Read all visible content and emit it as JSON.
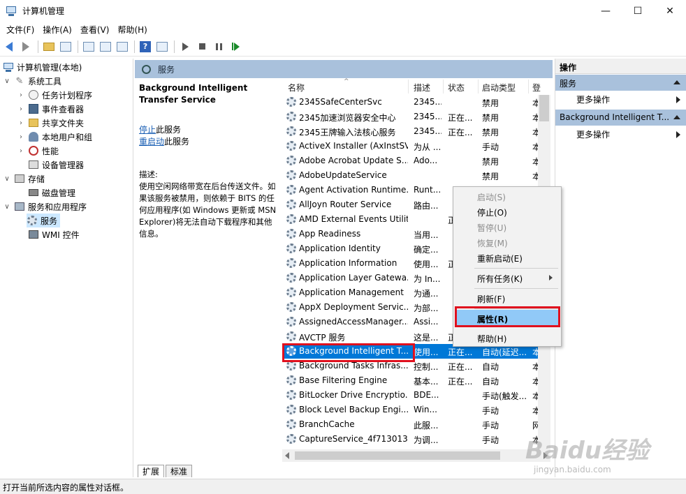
{
  "window": {
    "title": "计算机管理",
    "minimize": "—",
    "maximize": "☐",
    "close": "✕"
  },
  "menubar": [
    "文件(F)",
    "操作(A)",
    "查看(V)",
    "帮助(H)"
  ],
  "tree": [
    {
      "label": "计算机管理(本地)",
      "icon": "computer-icon",
      "twisty": ""
    },
    {
      "label": "系统工具",
      "icon": "tools-icon",
      "twisty": "∨"
    },
    {
      "label": "任务计划程序",
      "icon": "clock-icon",
      "twisty": "›"
    },
    {
      "label": "事件查看器",
      "icon": "event-viewer-icon",
      "twisty": "›"
    },
    {
      "label": "共享文件夹",
      "icon": "shared-folder-icon",
      "twisty": "›"
    },
    {
      "label": "本地用户和组",
      "icon": "users-icon",
      "twisty": "›"
    },
    {
      "label": "性能",
      "icon": "performance-icon",
      "twisty": "›"
    },
    {
      "label": "设备管理器",
      "icon": "device-manager-icon",
      "twisty": ""
    },
    {
      "label": "存储",
      "icon": "storage-icon",
      "twisty": "∨"
    },
    {
      "label": "磁盘管理",
      "icon": "disk-icon",
      "twisty": ""
    },
    {
      "label": "服务和应用程序",
      "icon": "services-apps-icon",
      "twisty": "∨"
    },
    {
      "label": "服务",
      "icon": "gear-icon",
      "twisty": ""
    },
    {
      "label": "WMI 控件",
      "icon": "wmi-icon",
      "twisty": ""
    }
  ],
  "center": {
    "header": "服务",
    "service_title": "Background Intelligent Transfer Service",
    "stop_link": "停止",
    "stop_suffix": "此服务",
    "restart_link": "重启动",
    "restart_suffix": "此服务",
    "desc_label": "描述:",
    "desc_body": "使用空闲网络带宽在后台传送文件。如果该服务被禁用，则依赖于 BITS 的任何应用程序(如 Windows 更新或 MSN Explorer)将无法自动下载程序和其他信息。"
  },
  "columns": [
    "名称",
    "描述",
    "状态",
    "启动类型",
    "登"
  ],
  "services": [
    {
      "name": "2345SafeCenterSvc",
      "desc": "2345...",
      "status": "",
      "startup": "禁用",
      "logon": "本"
    },
    {
      "name": "2345加速浏览器安全中心",
      "desc": "2345...",
      "status": "正在...",
      "startup": "禁用",
      "logon": "本"
    },
    {
      "name": "2345王牌输入法核心服务",
      "desc": "2345...",
      "status": "正在...",
      "startup": "禁用",
      "logon": "本"
    },
    {
      "name": "ActiveX Installer (AxInstSV)",
      "desc": "为从 ...",
      "status": "",
      "startup": "手动",
      "logon": "本"
    },
    {
      "name": "Adobe Acrobat Update S...",
      "desc": "Ado...",
      "status": "",
      "startup": "禁用",
      "logon": "本"
    },
    {
      "name": "AdobeUpdateService",
      "desc": "",
      "status": "",
      "startup": "禁用",
      "logon": "本"
    },
    {
      "name": "Agent Activation Runtime...",
      "desc": "Runt...",
      "status": "",
      "startup": "",
      "logon": ""
    },
    {
      "name": "AllJoyn Router Service",
      "desc": "路由...",
      "status": "",
      "startup": "",
      "logon": ""
    },
    {
      "name": "AMD External Events Utility",
      "desc": "",
      "status": "正",
      "startup": "",
      "logon": ""
    },
    {
      "name": "App Readiness",
      "desc": "当用...",
      "status": "",
      "startup": "",
      "logon": ""
    },
    {
      "name": "Application Identity",
      "desc": "确定...",
      "status": "",
      "startup": "",
      "logon": ""
    },
    {
      "name": "Application Information",
      "desc": "使用...",
      "status": "正",
      "startup": "",
      "logon": ""
    },
    {
      "name": "Application Layer Gatewa...",
      "desc": "为 In...",
      "status": "",
      "startup": "",
      "logon": ""
    },
    {
      "name": "Application Management",
      "desc": "为通...",
      "status": "",
      "startup": "",
      "logon": ""
    },
    {
      "name": "AppX Deployment Servic...",
      "desc": "为部...",
      "status": "",
      "startup": "",
      "logon": ""
    },
    {
      "name": "AssignedAccessManager...",
      "desc": "Assi...",
      "status": "",
      "startup": "",
      "logon": ""
    },
    {
      "name": "AVCTP 服务",
      "desc": "这是...",
      "status": "正",
      "startup": "",
      "logon": ""
    },
    {
      "name": "Background Intelligent T...",
      "desc": "使用...",
      "status": "正在...",
      "startup": "自动(延迟...",
      "logon": "本"
    },
    {
      "name": "Background Tasks Infras...",
      "desc": "控制...",
      "status": "正在...",
      "startup": "自动",
      "logon": "本"
    },
    {
      "name": "Base Filtering Engine",
      "desc": "基本...",
      "status": "正在...",
      "startup": "自动",
      "logon": "本"
    },
    {
      "name": "BitLocker Drive Encryptio...",
      "desc": "BDE...",
      "status": "",
      "startup": "手动(触发...",
      "logon": "本"
    },
    {
      "name": "Block Level Backup Engi...",
      "desc": "Win...",
      "status": "",
      "startup": "手动",
      "logon": "本"
    },
    {
      "name": "BranchCache",
      "desc": "此服...",
      "status": "",
      "startup": "手动",
      "logon": "网"
    },
    {
      "name": "CaptureService_4f713013",
      "desc": "为调...",
      "status": "",
      "startup": "手动",
      "logon": "本"
    }
  ],
  "tabs": [
    "扩展",
    "标准"
  ],
  "actions": {
    "title": "操作",
    "group1": "服务",
    "more1": "更多操作",
    "group2": "Background Intelligent T...",
    "more2": "更多操作"
  },
  "context_menu": [
    {
      "label": "启动(S)",
      "disabled": true
    },
    {
      "label": "停止(O)",
      "disabled": false
    },
    {
      "label": "暂停(U)",
      "disabled": true
    },
    {
      "label": "恢复(M)",
      "disabled": true
    },
    {
      "label": "重新启动(E)",
      "disabled": false
    },
    {
      "label": "所有任务(K)",
      "disabled": false,
      "submenu": true
    },
    {
      "label": "刷新(F)",
      "disabled": false
    },
    {
      "label": "属性(R)",
      "disabled": false,
      "highlighted": true
    },
    {
      "label": "帮助(H)",
      "disabled": false
    }
  ],
  "statusbar": "打开当前所选内容的属性对话框。",
  "watermark": {
    "logo": "Baidu经验",
    "url": "jingyan.baidu.com"
  },
  "colors": {
    "selection": "#0078d7",
    "header_band": "#a9c1dc",
    "highlight_red": "#e0101e",
    "menu_highlight": "#91c9f7"
  }
}
